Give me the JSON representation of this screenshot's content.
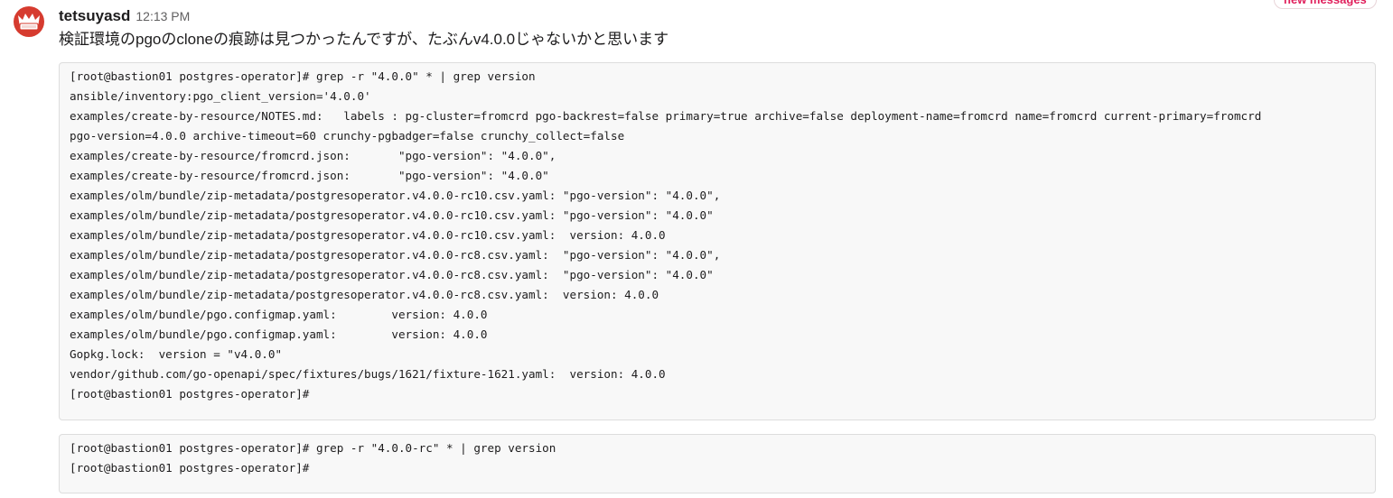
{
  "new_messages_label": "new messages",
  "message": {
    "username": "tetsuyasd",
    "timestamp": "12:13 PM",
    "text": "検証環境のpgoのcloneの痕跡は見つかったんですが、たぶんv4.0.0じゃないかと思います"
  },
  "code_blocks": [
    {
      "lines": [
        "[root@bastion01 postgres-operator]# grep -r \"4.0.0\" * | grep version",
        "ansible/inventory:pgo_client_version='4.0.0'",
        "examples/create-by-resource/NOTES.md:   labels : pg-cluster=fromcrd pgo-backrest=false primary=true archive=false deployment-name=fromcrd name=fromcrd current-primary=fromcrd",
        "pgo-version=4.0.0 archive-timeout=60 crunchy-pgbadger=false crunchy_collect=false",
        "examples/create-by-resource/fromcrd.json:       \"pgo-version\": \"4.0.0\",",
        "examples/create-by-resource/fromcrd.json:       \"pgo-version\": \"4.0.0\"",
        "examples/olm/bundle/zip-metadata/postgresoperator.v4.0.0-rc10.csv.yaml: \"pgo-version\": \"4.0.0\",",
        "examples/olm/bundle/zip-metadata/postgresoperator.v4.0.0-rc10.csv.yaml: \"pgo-version\": \"4.0.0\"",
        "examples/olm/bundle/zip-metadata/postgresoperator.v4.0.0-rc10.csv.yaml:  version: 4.0.0",
        "examples/olm/bundle/zip-metadata/postgresoperator.v4.0.0-rc8.csv.yaml:  \"pgo-version\": \"4.0.0\",",
        "examples/olm/bundle/zip-metadata/postgresoperator.v4.0.0-rc8.csv.yaml:  \"pgo-version\": \"4.0.0\"",
        "examples/olm/bundle/zip-metadata/postgresoperator.v4.0.0-rc8.csv.yaml:  version: 4.0.0",
        "examples/olm/bundle/pgo.configmap.yaml:        version: 4.0.0",
        "examples/olm/bundle/pgo.configmap.yaml:        version: 4.0.0",
        "Gopkg.lock:  version = \"v4.0.0\"",
        "vendor/github.com/go-openapi/spec/fixtures/bugs/1621/fixture-1621.yaml:  version: 4.0.0",
        "[root@bastion01 postgres-operator]#"
      ]
    },
    {
      "lines": [
        "[root@bastion01 postgres-operator]# grep -r \"4.0.0-rc\" * | grep version",
        "[root@bastion01 postgres-operator]#"
      ]
    }
  ],
  "avatar_icon": "crown-avatar-icon",
  "colors": {
    "accent_new_messages": "#e01e5a",
    "avatar_red": "#d63b2f",
    "code_bg": "#f8f8f8"
  }
}
